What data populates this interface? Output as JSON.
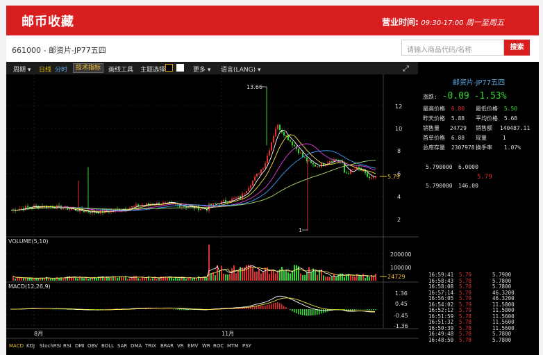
{
  "header": {
    "brand": "邮币收藏",
    "hours_label": "营业时间:",
    "hours_time": "09:30-17:00",
    "hours_days": "周一至周五"
  },
  "subbar": {
    "product_code": "661000 - 邮资片-JP77五四",
    "search_placeholder": "请输入商品代码/名称",
    "search_button": "搜索"
  },
  "toolbar": {
    "items": [
      "周期 ▾",
      "日线",
      "分时",
      "技术指标",
      "画线工具",
      "主题选择",
      "更多 ▾",
      "语言(LANG) ▾"
    ]
  },
  "main_chart": {
    "price_ticks": [
      "12",
      "10",
      "8",
      "6",
      "4",
      "2"
    ],
    "high_label": "13.66",
    "low_label": "1",
    "last_price": "5.79"
  },
  "volume_chart": {
    "title": "VOLUME(5,10)",
    "ticks": [
      "200000",
      "100000"
    ],
    "last_volume": "24729"
  },
  "macd_chart": {
    "title": "MACD(12,26,9)",
    "ticks": [
      "1.36",
      "0.45",
      "-0.45",
      "-1.36"
    ]
  },
  "x_axis": {
    "labels": [
      "8月",
      "11月"
    ]
  },
  "indicators": [
    "MACD",
    "KDJ",
    "StochRSI",
    "RSI",
    "DMI",
    "OBV",
    "BOLL",
    "SAR",
    "DMA",
    "TRIX",
    "BRAR",
    "VR",
    "EMV",
    "WR",
    "ROC",
    "MTM",
    "PSY"
  ],
  "quote": {
    "name": "邮资片-JP77五四",
    "change_label": "涨跌:",
    "change_value": "-0.09",
    "change_pct": "-1.53%",
    "high_label": "最高价格",
    "high_value": "6.80",
    "low_label": "最低价格",
    "low_value": "5.50",
    "prev_label": "昨天价格",
    "prev_value": "5.88",
    "avg_label": "平均价格",
    "avg_value": "5.68",
    "vol_label": "销售量",
    "vol_value": "24729",
    "amt_label": "销售额",
    "amt_value": "140487.11",
    "first_label": "首单价格",
    "first_value": "6.88",
    "cur_label": "现量",
    "cur_value": "1",
    "stock_label": "总库存量",
    "stock_value": "2307978",
    "turnover_label": "换手率",
    "turnover_value": "1.07%"
  },
  "orderbook": {
    "sell_price": "5.790000",
    "sell_qty": "6.0000",
    "mid": "5.79",
    "buy_price": "5.790000",
    "buy_qty": "146.00"
  },
  "trades": [
    {
      "time": "16:59:41",
      "price": "5.79",
      "qty": "5.7900"
    },
    {
      "time": "16:58:43",
      "price": "5.78",
      "qty": "5.7800"
    },
    {
      "time": "16:58:08",
      "price": "5.78",
      "qty": "5.7800"
    },
    {
      "time": "16:57:14",
      "price": "5.79",
      "qty": "46.3200"
    },
    {
      "time": "16:56:05",
      "price": "5.79",
      "qty": "46.3200"
    },
    {
      "time": "16:54:02",
      "price": "5.79",
      "qty": "11.5800"
    },
    {
      "time": "16:52:12",
      "price": "5.79",
      "qty": "11.5800"
    },
    {
      "time": "16:51:59",
      "price": "5.78",
      "qty": "11.5600"
    },
    {
      "time": "16:51:32",
      "price": "5.78",
      "qty": "11.5600"
    },
    {
      "time": "16:50:39",
      "price": "5.78",
      "qty": "11.5600"
    },
    {
      "time": "16:49:48",
      "price": "5.78",
      "qty": "5.7800"
    },
    {
      "time": "16:48:50",
      "price": "5.78",
      "qty": "5.7800"
    }
  ],
  "colors": {
    "brand_red": "#d81e1e",
    "up": "#e03030",
    "down": "#32d632",
    "background": "#000000",
    "ma5": "#ffffff",
    "ma10": "#f0e040",
    "ma20": "#e040e0",
    "ma30": "#40a0ff",
    "ma60": "#b0e070"
  }
}
